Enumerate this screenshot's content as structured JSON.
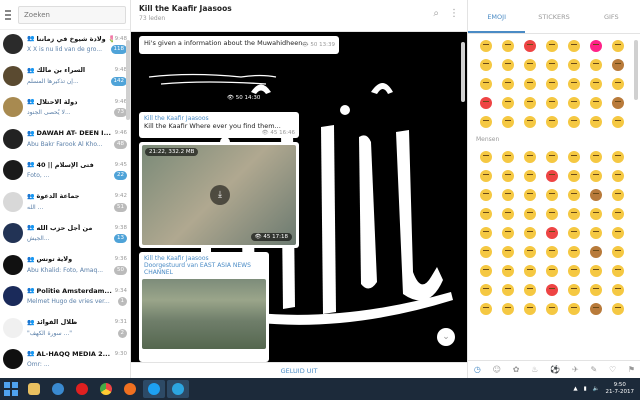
{
  "sidebar": {
    "search_placeholder": "Zoeken",
    "chats": [
      {
        "title": "ولادة شيوخ في زماننا 🌷",
        "time": "9:48",
        "preview": "X X is nu lid van de gro...",
        "badge": "118",
        "badge_color": "blue",
        "avatar_color": "#2b2b2b",
        "group": true
      },
      {
        "title": "السراء بن مالك",
        "time": "9:48",
        "preview": "إن تذكيرها المسلم...",
        "badge": "142",
        "badge_color": "blue",
        "avatar_color": "#5a4a30",
        "group": true
      },
      {
        "title": "دولة الاحتلال",
        "time": "9:46",
        "preview": "لا يُحصى الجنود...",
        "badge": "73",
        "badge_color": "gray",
        "avatar_color": "#a88a50",
        "group": true
      },
      {
        "title": "DAWAH AT- DEEN I...",
        "time": "9:46",
        "preview": "Abu Bakr Farook Al Kho...",
        "badge": "48",
        "badge_color": "gray",
        "avatar_color": "#222222",
        "group": true
      },
      {
        "title": "فتى الإسلام || 40",
        "time": "9:45",
        "preview": "Foto, ...",
        "badge": "22",
        "badge_color": "blue",
        "avatar_color": "#1a1a1a",
        "group": true
      },
      {
        "title": "جماعة الدعوة",
        "time": "9:42",
        "preview": "الله ...",
        "badge": "51",
        "badge_color": "gray",
        "avatar_color": "#d8d8d8",
        "group": true
      },
      {
        "title": "من أجل حزب الله",
        "time": "9:38",
        "preview": "الجيش...",
        "badge": "13",
        "badge_color": "blue",
        "avatar_color": "#223355",
        "group": true
      },
      {
        "title": "ولاية تونس",
        "time": "9:36",
        "preview": "Abu Khalid: Foto, Amaq...",
        "badge": "50",
        "badge_color": "gray",
        "avatar_color": "#111111",
        "group": true
      },
      {
        "title": "Politie Amsterdam...",
        "time": "9:34",
        "preview": "Melmet Hugo de vries ver...",
        "badge": "1",
        "badge_color": "gray",
        "avatar_color": "#1a2a5a",
        "group": true
      },
      {
        "title": "ظلال الفوائد",
        "time": "9:31",
        "preview": "\"سورة الكهف ...\"",
        "badge": "2",
        "badge_color": "gray",
        "avatar_color": "#f0f0f0",
        "group": true
      },
      {
        "title": "AL-HAQQ MEDIA 2...",
        "time": "9:30",
        "preview": "Omr: ...",
        "badge": "",
        "badge_color": "gray",
        "avatar_color": "#101010",
        "group": true
      }
    ]
  },
  "chat": {
    "title": "Kill the Kaafir Jaasoos",
    "subtitle": "73 leden",
    "messages": [
      {
        "text": "Hi's given a information about the Muwahidheen...",
        "views": "50",
        "time": "13:39"
      },
      {
        "views": "50",
        "time": "14:30"
      },
      {
        "forward": "Kill the Kaafir Jaasoos",
        "text": "Kill the Kaafir Where ever you find them...",
        "views": "45",
        "time": "16:46"
      },
      {
        "video_label": "21:22, 332.2 MB",
        "views": "45",
        "time": "17:18"
      },
      {
        "forward": "Kill the Kaafir Jaasoos",
        "forward2": "Doorgestuurd van EAST ASIA NEWS CHANNEL"
      }
    ],
    "bottom_action": "GELUID UIT"
  },
  "emoji_panel": {
    "tabs": [
      "EMOJI",
      "STICKERS",
      "GIFS"
    ],
    "active_tab": "EMOJI",
    "section_label": "Mensen"
  },
  "taskbar": {
    "time": "9:50",
    "date": "21-7-2017",
    "apps": [
      "explorer",
      "media-player",
      "opera",
      "chrome",
      "firefox",
      "skype",
      "telegram"
    ]
  }
}
